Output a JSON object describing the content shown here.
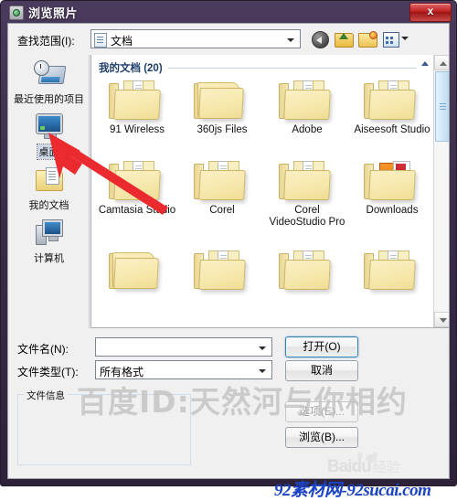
{
  "window": {
    "title": "浏览照片",
    "title_icon": "photo-app-icon",
    "close_label": "x"
  },
  "toolbar": {
    "lookin_label": "查找范围(I):",
    "lookin_value": "文档",
    "lookin_icon": "document-icon",
    "buttons": [
      {
        "name": "back-button",
        "icon": "back-arrow-icon"
      },
      {
        "name": "up-one-level-button",
        "icon": "up-folder-icon"
      },
      {
        "name": "new-folder-button",
        "icon": "new-folder-icon"
      },
      {
        "name": "views-button",
        "icon": "views-grid-icon"
      }
    ]
  },
  "places": [
    {
      "label": "最近使用的项目",
      "icon": "recent-items-icon",
      "selected": false
    },
    {
      "label": "桌面",
      "icon": "desktop-icon",
      "selected": true
    },
    {
      "label": "我的文档",
      "icon": "my-documents-icon",
      "selected": false
    },
    {
      "label": "计算机",
      "icon": "computer-icon",
      "selected": false
    }
  ],
  "filelist": {
    "group_title": "我的文档 (20)",
    "items": [
      {
        "name": "91 Wireless",
        "icon": "folder-with-files-icon"
      },
      {
        "name": "360js Files",
        "icon": "folder-plain-icon"
      },
      {
        "name": "Adobe",
        "icon": "folder-with-files-icon"
      },
      {
        "name": "Aiseesoft Studio",
        "icon": "folder-with-files-icon"
      },
      {
        "name": "Camtasia Studio",
        "icon": "folder-with-files-icon"
      },
      {
        "name": "Corel",
        "icon": "folder-with-files-icon"
      },
      {
        "name": "Corel VideoStudio Pro",
        "icon": "folder-with-files-icon"
      },
      {
        "name": "Downloads",
        "icon": "folder-with-pdf-icon"
      },
      {
        "name": "",
        "icon": "folder-plain-icon"
      },
      {
        "name": "",
        "icon": "folder-with-files-icon"
      },
      {
        "name": "",
        "icon": "folder-with-files-icon"
      },
      {
        "name": "",
        "icon": "folder-with-files-icon"
      }
    ]
  },
  "form": {
    "filename_label": "文件名(N):",
    "filename_value": "",
    "filetype_label": "文件类型(T):",
    "filetype_value": "所有格式",
    "open_button": "打开(O)",
    "cancel_button": "取消",
    "options_button": "选项(E)...",
    "browse_button": "浏览(B)...",
    "fileinfo_caption": "文件信息",
    "fileinfo_value": ""
  },
  "annotations": {
    "arrow": "red-arrow-pointing-to-desktop",
    "watermark_center": "百度ID:天然河与你相约",
    "watermark_baidu_brand": "Baidu",
    "watermark_baidu_suffix": "经验",
    "watermark_bottom": "92素材网-92sucai.com"
  },
  "colors": {
    "frame": "#3b2d4b",
    "close": "#c22020",
    "accent": "#3c7fb1",
    "group_title": "#1f3e6e",
    "arrow": "#e8262a"
  }
}
